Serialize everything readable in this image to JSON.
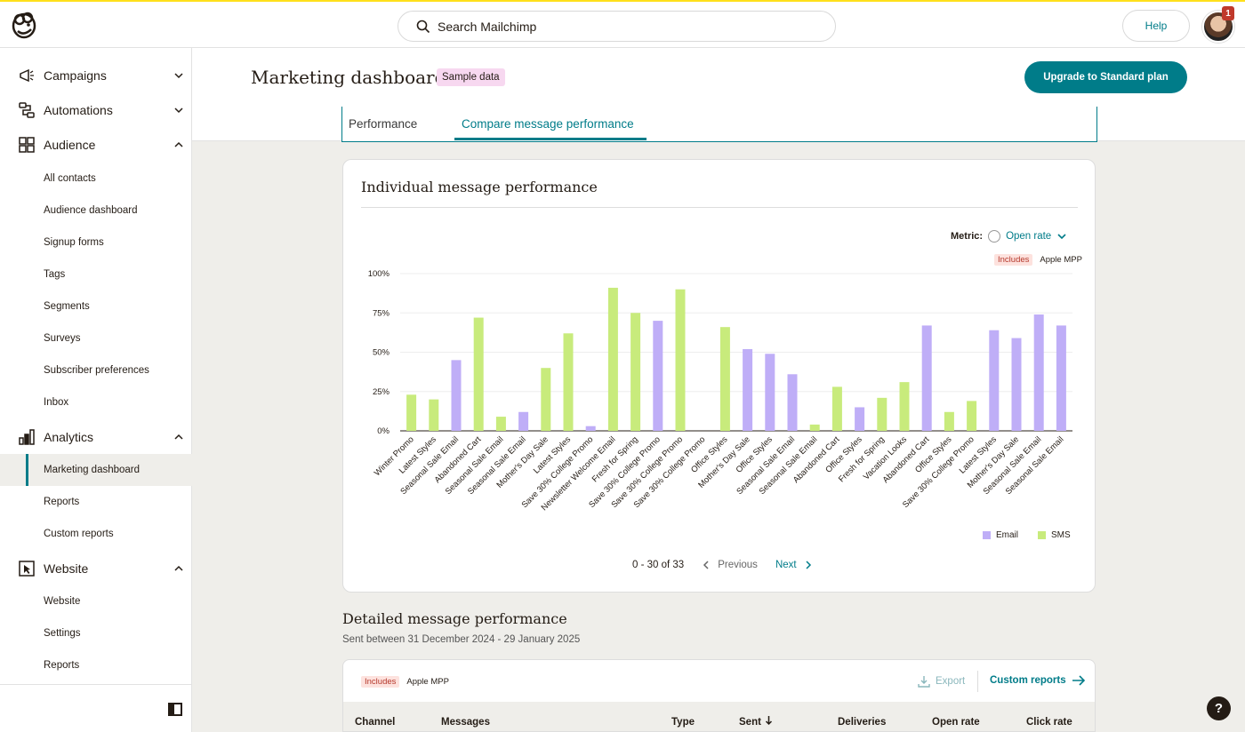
{
  "topbar": {
    "search_placeholder": "Search Mailchimp",
    "help_label": "Help",
    "notification_count": "1"
  },
  "sidebar": {
    "campaigns": "Campaigns",
    "automations": "Automations",
    "audience": "Audience",
    "audience_items": [
      "All contacts",
      "Audience dashboard",
      "Signup forms",
      "Tags",
      "Segments",
      "Surveys",
      "Subscriber preferences",
      "Inbox"
    ],
    "analytics": "Analytics",
    "analytics_items": [
      "Marketing dashboard",
      "Reports",
      "Custom reports"
    ],
    "website": "Website",
    "website_items": [
      "Website",
      "Settings",
      "Reports"
    ]
  },
  "header": {
    "title": "Marketing dashboard",
    "badge": "Sample data",
    "upgrade": "Upgrade to Standard plan"
  },
  "tabs": {
    "performance": "Performance",
    "compare": "Compare message performance"
  },
  "card": {
    "title": "Individual message performance",
    "metric_label": "Metric:",
    "metric_value": "Open rate",
    "includes_badge": "Includes",
    "includes_text": "Apple MPP",
    "pager_range": "0 - 30 of 33",
    "previous": "Previous",
    "next": "Next"
  },
  "chart_data": {
    "type": "bar",
    "yticks": [
      "100%",
      "75%",
      "50%",
      "25%",
      "0%"
    ],
    "ylim": [
      0,
      100
    ],
    "grid": true,
    "legend_position": "bottom-right",
    "colors": {
      "Email": "#bfaef7",
      "SMS": "#c8eb7c"
    },
    "legend": [
      "Email",
      "SMS"
    ],
    "categories": [
      "Winter Promo",
      "Latest Styles",
      "Seasonal Sale Email",
      "Abandoned Cart",
      "Seasonal Sale Email",
      "Seasonal Sale Email",
      "Mother's Day Sale",
      "Latest Styles",
      "Save 30% College Promo",
      "Newsletter Welcome Email",
      "Fresh for Spring",
      "Save 30% College Promo",
      "Save 30% College Promo",
      "Save 30% College Promo",
      "Office Styles",
      "Mother's Day Sale",
      "Office Styles",
      "Seasonal Sale Email",
      "Seasonal Sale Email",
      "Abandoned Cart",
      "Office Styles",
      "Fresh for Spring",
      "Vacation Looks",
      "Abandoned Cart",
      "Office Styles",
      "Save 30% College Promo",
      "Latest Styles",
      "Mother's Day Sale",
      "Seasonal Sale Email",
      "Seasonal Sale Email"
    ],
    "channels": [
      "SMS",
      "SMS",
      "Email",
      "SMS",
      "SMS",
      "Email",
      "SMS",
      "SMS",
      "Email",
      "SMS",
      "SMS",
      "Email",
      "SMS",
      "SMS",
      "SMS",
      "Email",
      "Email",
      "Email",
      "SMS",
      "SMS",
      "Email",
      "SMS",
      "SMS",
      "Email",
      "SMS",
      "SMS",
      "Email",
      "Email",
      "Email",
      "Email"
    ],
    "values": [
      23,
      20,
      45,
      72,
      9,
      12,
      40,
      62,
      3,
      91,
      75,
      70,
      90,
      0,
      66,
      52,
      49,
      36,
      4,
      28,
      15,
      21,
      31,
      67,
      12,
      19,
      64,
      59,
      74,
      67
    ]
  },
  "detail": {
    "title": "Detailed message performance",
    "subtitle": "Sent between 31 December 2024 - 29 January 2025",
    "includes_badge": "Includes",
    "includes_text": "Apple MPP",
    "export": "Export",
    "custom_reports": "Custom reports",
    "columns": [
      "Channel",
      "Messages",
      "Type",
      "Sent",
      "Deliveries",
      "Open rate",
      "Click rate"
    ]
  },
  "help_fab": "?"
}
